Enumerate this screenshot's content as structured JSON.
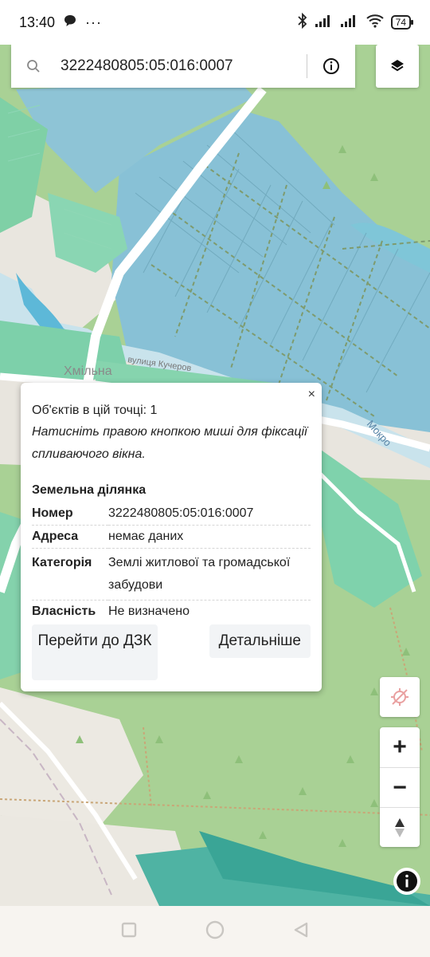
{
  "status_bar": {
    "time": "13:40",
    "chat_icon": "chat-bubble-icon",
    "more": "···",
    "battery": "74"
  },
  "search": {
    "value": "3222480805:05:016:0007",
    "placeholder": ""
  },
  "map_labels": {
    "village": "Хмільна",
    "street": "вулиця Кучеров",
    "river": "Мокро"
  },
  "popup": {
    "close": "×",
    "count_text": "Об'єктів в цій точці: 1",
    "hint": "Натисніть правою кнопкою миші для фіксації спливаючого вікна.",
    "section_title": "Земельна ділянка",
    "rows": [
      {
        "label": "Номер",
        "value": "3222480805:05:016:0007"
      },
      {
        "label": "Адреса",
        "value": "немає даних"
      },
      {
        "label": "Категорія",
        "value": "Землі житлової та громадської забудови"
      },
      {
        "label": "Власність",
        "value": "Не визначено"
      }
    ],
    "btn_dzk": "Перейти до ДЗК",
    "btn_details": "Детальніше"
  },
  "controls": {
    "zoom_in": "+",
    "zoom_out": "−"
  },
  "colors": {
    "forest": "#a8cf94",
    "parcel_blue": "#88c2d6",
    "parcel_green": "#7fd3b0",
    "road": "#ffffff",
    "water": "#5bb7d9"
  }
}
